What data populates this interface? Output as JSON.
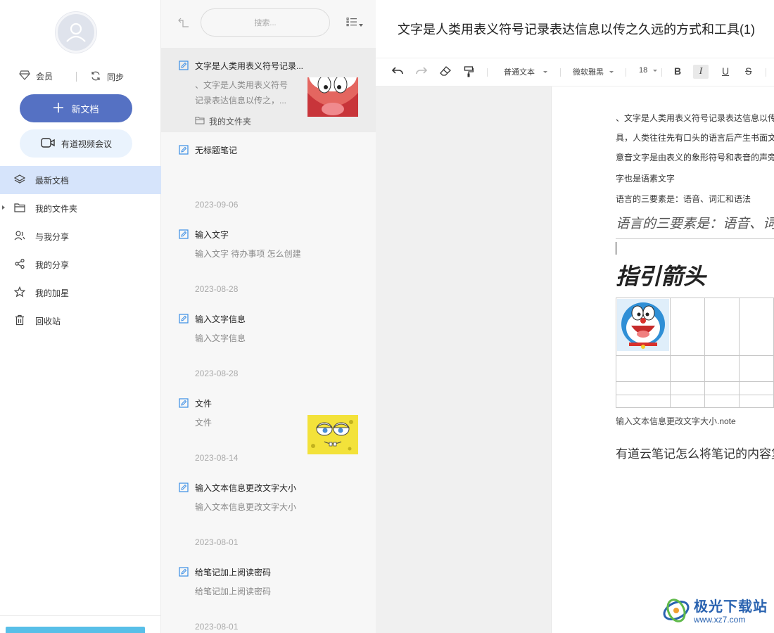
{
  "sidebar": {
    "vip_label": "会员",
    "sync_label": "同步",
    "new_doc_label": "新文档",
    "video_meeting_label": "有道视频会议",
    "nav": [
      {
        "label": "最新文档",
        "icon": "layers-icon"
      },
      {
        "label": "我的文件夹",
        "icon": "folder-icon"
      },
      {
        "label": "与我分享",
        "icon": "people-icon"
      },
      {
        "label": "我的分享",
        "icon": "share-icon"
      },
      {
        "label": "我的加星",
        "icon": "star-icon"
      },
      {
        "label": "回收站",
        "icon": "trash-icon"
      }
    ]
  },
  "list": {
    "search_placeholder": "搜索...",
    "notes": [
      {
        "title": "文字是人类用表义符号记录...",
        "snippet": "、文字是人类用表义符号记录表达信息以传之，...",
        "folder": "我的文件夹"
      },
      {
        "title": "无标题笔记",
        "snippet": "",
        "date": "2023-09-06"
      },
      {
        "title": "输入文字",
        "snippet": "输入文字 待办事项 怎么创建",
        "date": "2023-08-28"
      },
      {
        "title": "输入文字信息",
        "snippet": "输入文字信息",
        "date": "2023-08-28"
      },
      {
        "title": "文件",
        "snippet": "文件",
        "date": "2023-08-14"
      },
      {
        "title": "输入文本信息更改文字大小",
        "snippet": "输入文本信息更改文字大小",
        "date": "2023-08-01"
      },
      {
        "title": "给笔记加上阅读密码",
        "snippet": "给笔记加上阅读密码",
        "date": "2023-08-01"
      }
    ]
  },
  "editor": {
    "title": "文字是人类用表义符号记录表达信息以传之久远的方式和工具(1)",
    "toolbar": {
      "paragraph_style": "普通文本",
      "font": "微软雅黑",
      "size": "18",
      "bold": "B",
      "italic": "I",
      "underline": "U",
      "strike": "S"
    },
    "lines": [
      "、文字是人类用表义符号记录表达信息以传之久远的方式和工",
      "具，人类往往先有口头的语言后产生书面文字，很多小语种，有语言但没有文字。文字的不同体现了国家和民族的书面表达的方式和思维不同。文字使人类进入有历史记录的文明社会。根据文字的表",
      "意音文字是由表义的象形符号和表音的声旁组成的文字，汉",
      "字也是语素文字",
      "语言的三要素是：语音、词汇和语法"
    ],
    "italic_line": "语言的三要素是：语音、词汇和语法",
    "heading": "指引箭头",
    "attachment": "输入文本信息更改文字大小.note",
    "big_line": "有道云笔记怎么将笔记的内容复制"
  },
  "watermark": {
    "name": "极光下载站",
    "url": "www.xz7.com"
  }
}
